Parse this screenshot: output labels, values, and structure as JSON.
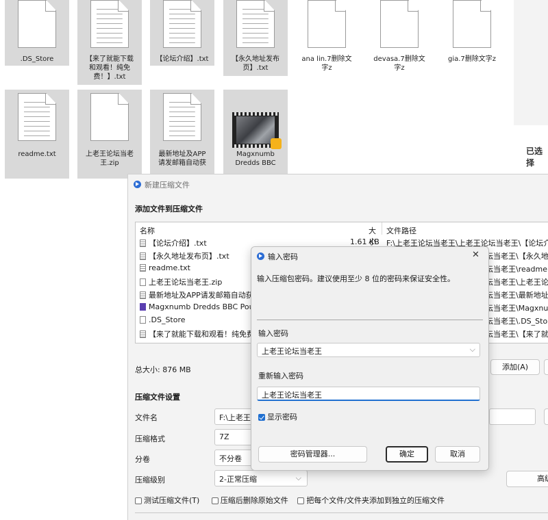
{
  "explorer": {
    "row1": [
      {
        "name": ".DS_Store",
        "icon": "blank-document-icon",
        "selected": true
      },
      {
        "name": "【来了就能下载和观看！纯免费！】.txt",
        "line1": "【来了就能下载",
        "line2": "和观看！纯免",
        "line3": "费！】.txt",
        "icon": "text-document-icon",
        "selected": true
      },
      {
        "name": "【论坛介绍】.txt",
        "icon": "text-document-icon",
        "selected": true
      },
      {
        "name": "【永久地址发布页】.txt",
        "line1": "【永久地址发布",
        "line2": "页】.txt",
        "icon": "text-document-icon",
        "selected": true
      },
      {
        "name": "ana lin.7删除文字z",
        "line1": "ana lin.7删除文",
        "line2": "字z",
        "icon": "blank-document-icon",
        "selected": false
      },
      {
        "name": "devasa.7删除文字z",
        "line1": "devasa.7删除文",
        "line2": "字z",
        "icon": "blank-document-icon",
        "selected": false
      },
      {
        "name": "gia.7删除文字z",
        "icon": "blank-document-icon",
        "selected": false
      }
    ],
    "row2": [
      {
        "name": "readme.txt",
        "icon": "text-document-icon",
        "selected": true
      },
      {
        "name": "上老王论坛当老王.zip",
        "line1": "上老王论坛当老",
        "line2": "王.zip",
        "icon": "blank-document-icon",
        "selected": true
      },
      {
        "name": "最新地址及APP请发邮箱自动获取.txt",
        "line1": "最新地址及APP",
        "line2": "请发邮箱自动获",
        "icon": "text-document-icon",
        "selected": true
      },
      {
        "name": "Magxnumb Dredds BBC",
        "line1": "Magxnumb",
        "line2": "Dredds BBC",
        "icon": "video-thumbnail-icon",
        "badge": "Player",
        "selected": true
      }
    ],
    "right_fragment": "已选择"
  },
  "main_dialog": {
    "title": "新建压缩文件",
    "section_add": "添加文件到压缩文件",
    "columns": {
      "name": "名称",
      "size": "大小",
      "path": "文件路径"
    },
    "files": [
      {
        "name": "【论坛介绍】.txt",
        "size": "1.61 KB",
        "path": "F:\\上老王论坛当老王\\上老王论坛当老王\\【论坛介",
        "icon": "text"
      },
      {
        "name": "【永久地址发布页】.txt",
        "size": "",
        "path": "坛当老王\\【永久地",
        "icon": "text"
      },
      {
        "name": "readme.txt",
        "size": "",
        "path": "坛当老王\\readme.",
        "icon": "text"
      },
      {
        "name": "上老王论坛当老王.zip",
        "size": "",
        "path": "坛当老王\\上老王论",
        "icon": "blank"
      },
      {
        "name": "最新地址及APP请发邮箱自动获",
        "size": "",
        "path": "坛当老王\\最新地址",
        "icon": "text"
      },
      {
        "name": "Magxnumb Dredds BBC Pou",
        "size": "",
        "path": "坛当老王\\Magxnu",
        "icon": "video"
      },
      {
        "name": ".DS_Store",
        "size": "",
        "path": "坛当老王\\.DS_Stor",
        "icon": "blank"
      },
      {
        "name": "【来了就能下载和观看！纯免费",
        "size": "",
        "path": "坛当老王\\【来了就",
        "icon": "text"
      }
    ],
    "total_size": "总大小: 876 MB",
    "add_button": "添加(A)",
    "section_settings": "压缩文件设置",
    "labels": {
      "filename": "文件名",
      "format": "压缩格式",
      "split": "分卷",
      "level": "压缩级别"
    },
    "values": {
      "filename": "F:\\上老王",
      "format": "7Z",
      "split": "不分卷",
      "level": "2-正常压缩"
    },
    "advanced_button": "高级",
    "options": [
      {
        "label": "测试压缩文件(T)",
        "checked": false
      },
      {
        "label": "压缩后删除原始文件",
        "checked": false
      },
      {
        "label": "把每个文件/文件夹添加到独立的压缩文件",
        "checked": false
      }
    ]
  },
  "password_dialog": {
    "title": "输入密码",
    "close": "✕",
    "description": "输入压缩包密码。建议使用至少 8 位的密码来保证安全性。",
    "label_password": "输入密码",
    "password_value": "上老王论坛当老王",
    "label_reenter": "重新输入密码",
    "reenter_value": "上老王论坛当老王",
    "show_password_label": "显示密码",
    "show_password_checked": true,
    "manager_button": "密码管理器...",
    "ok_button": "确定",
    "cancel_button": "取消"
  }
}
